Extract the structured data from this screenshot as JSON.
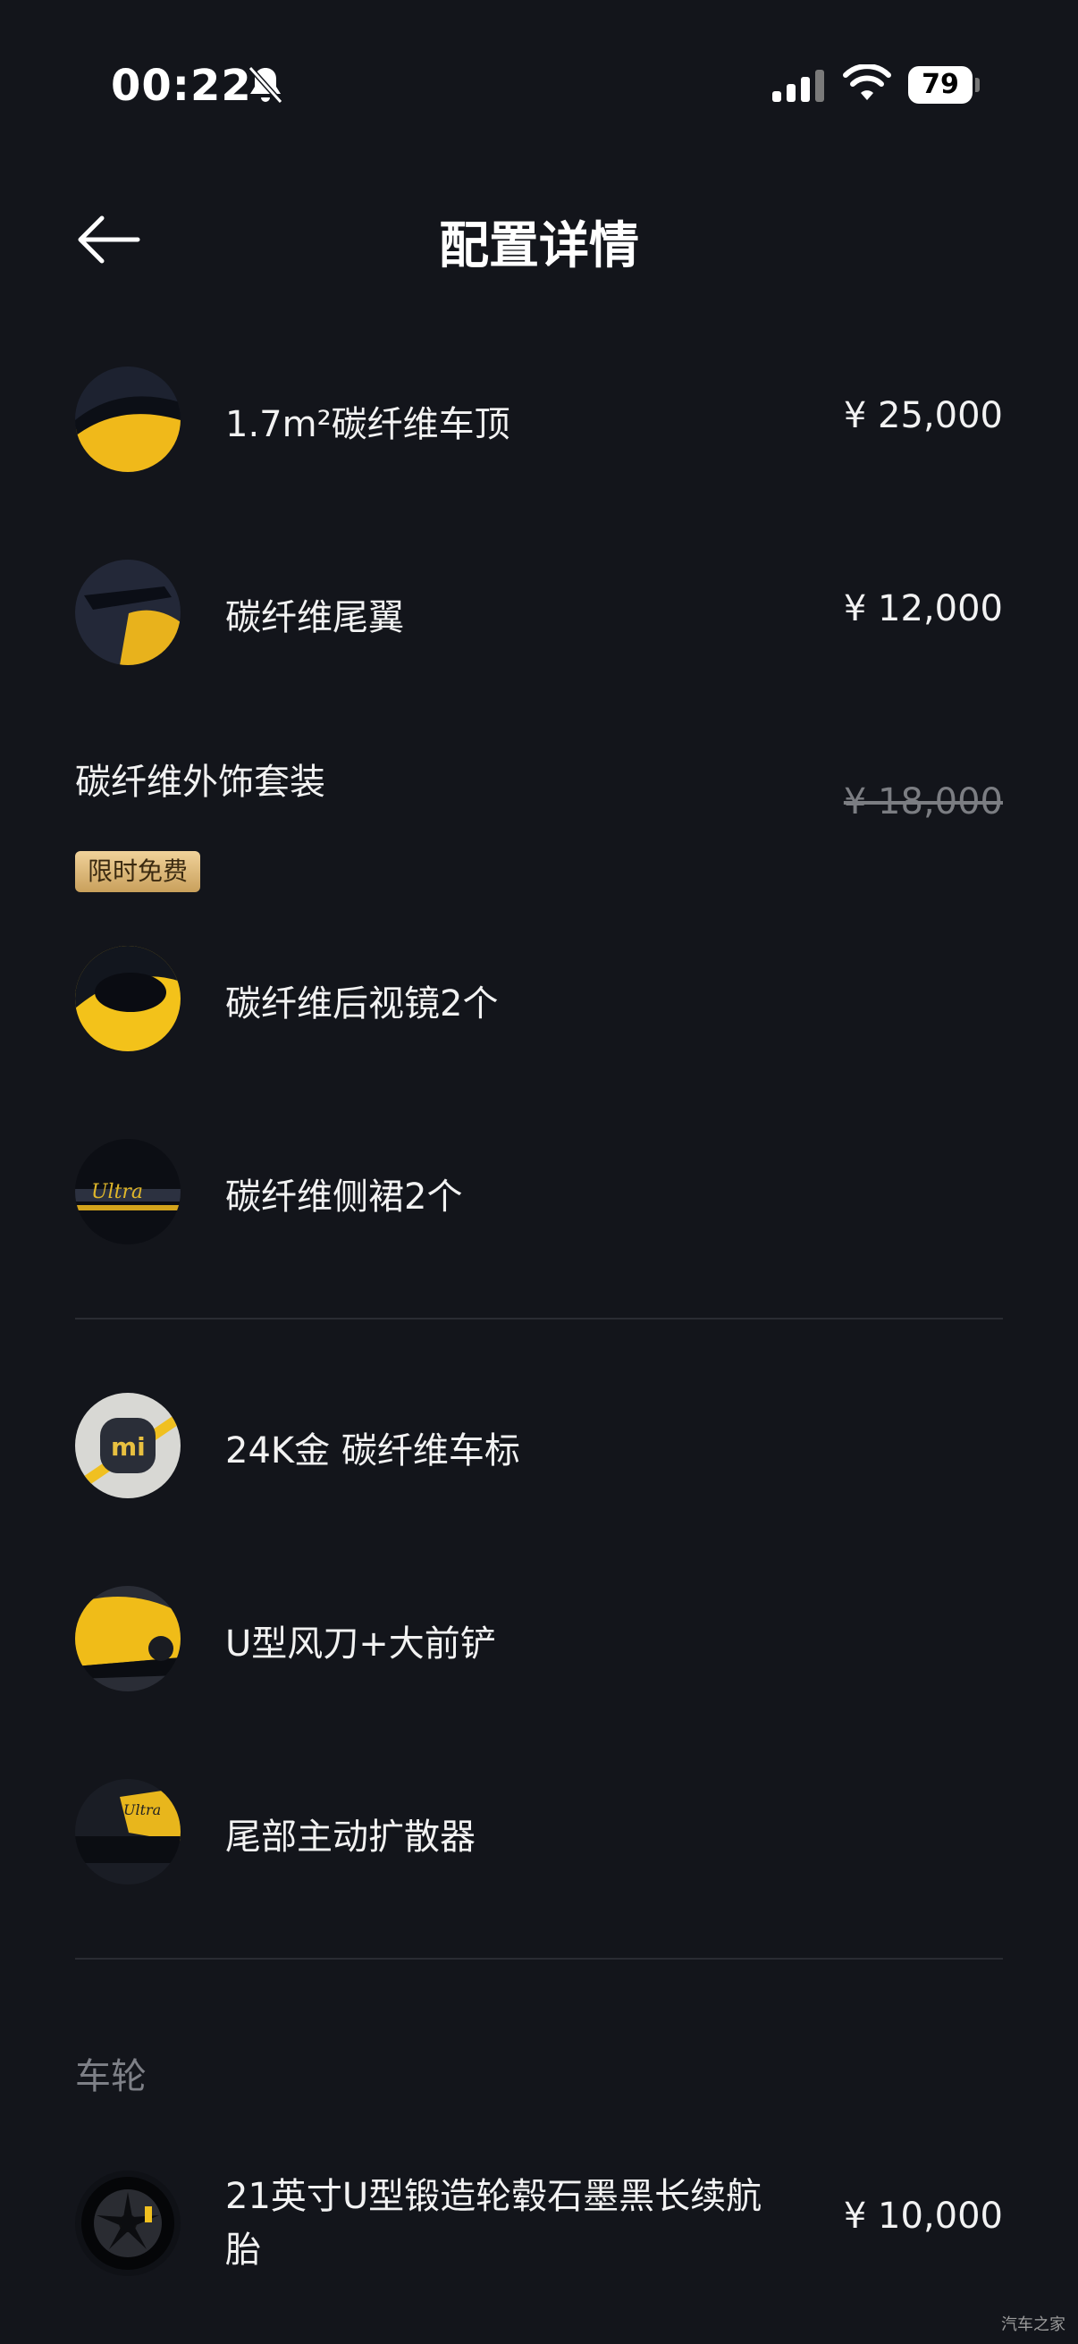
{
  "status": {
    "time": "00:22",
    "battery": "79",
    "icons": [
      "mute-icon",
      "signal-icon",
      "wifi-icon",
      "battery-icon"
    ]
  },
  "header": {
    "title": "配置详情",
    "back_icon": "back-arrow-icon"
  },
  "items": [
    {
      "label": "1.7m²碳纤维车顶",
      "price": "¥ 25,000"
    },
    {
      "label": "碳纤维尾翼",
      "price": "¥ 12,000"
    },
    {
      "label": "碳纤维外饰套装",
      "badge": "限时免费",
      "price": "¥ 18,000"
    },
    {
      "label": "碳纤维后视镜2个"
    },
    {
      "label": "碳纤维侧裙2个"
    },
    {
      "label": "24K金 碳纤维车标"
    },
    {
      "label": "U型风刀+大前铲"
    },
    {
      "label": "尾部主动扩散器"
    }
  ],
  "wheels": {
    "section_title": "车轮",
    "label_line1": "21英寸U型锻造轮毂石墨黑长续航",
    "label_line2": "胎",
    "price": "¥ 10,000"
  },
  "watermark": "汽车之家",
  "colors": {
    "background": "#13151b",
    "badge": "#d9b16f",
    "accent_yellow": "#f3c21a"
  }
}
